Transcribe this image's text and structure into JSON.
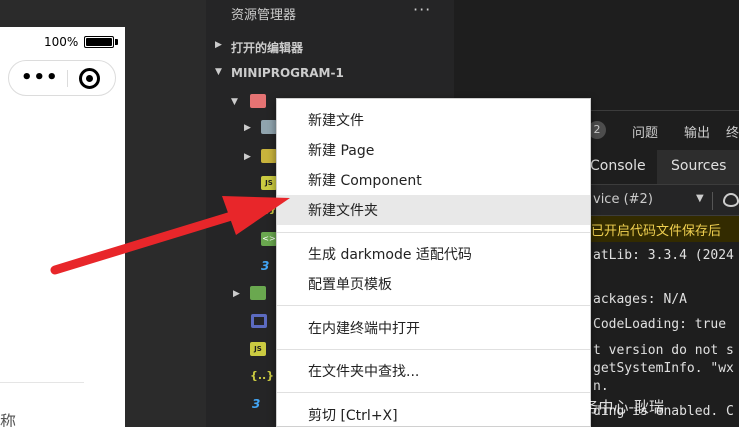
{
  "simulator": {
    "battery_percent": "100%",
    "capsule_dots": "•••",
    "bottom_text": "称"
  },
  "explorer": {
    "title": "资源管理器",
    "more": "···",
    "sections": {
      "open_editors": "打开的编辑器",
      "project": "MINIPROGRAM-1"
    }
  },
  "panel": {
    "badge_count": "2",
    "tabs": [
      "问题",
      "输出",
      "终"
    ],
    "console_tabs": [
      "Console",
      "Sources"
    ],
    "device": "vice (#2)",
    "warning": "已开启代码文件保存后",
    "lines": [
      "atLib: 3.3.4 (2024",
      "ackages: N/A",
      "CodeLoading: true",
      "t version do not s",
      "getSystemInfo. \"wx",
      "n.",
      "ding is enabled. C"
    ]
  },
  "context_menu": {
    "items": [
      "新建文件",
      "新建 Page",
      "新建 Component",
      "新建文件夹",
      "生成 darkmode 适配代码",
      "配置单页模板",
      "在内建终端中打开",
      "在文件夹中查找...",
      "剪切  [Ctrl+X]"
    ],
    "hovered_index": 3
  },
  "watermark": "CSDN @瑞晟技术服务中心-耿瑞",
  "colors": {
    "arrow": "#e8262a",
    "menu_hover": "#e8e8e8",
    "sidebar": "#252526",
    "editor": "#1e1e1e"
  }
}
